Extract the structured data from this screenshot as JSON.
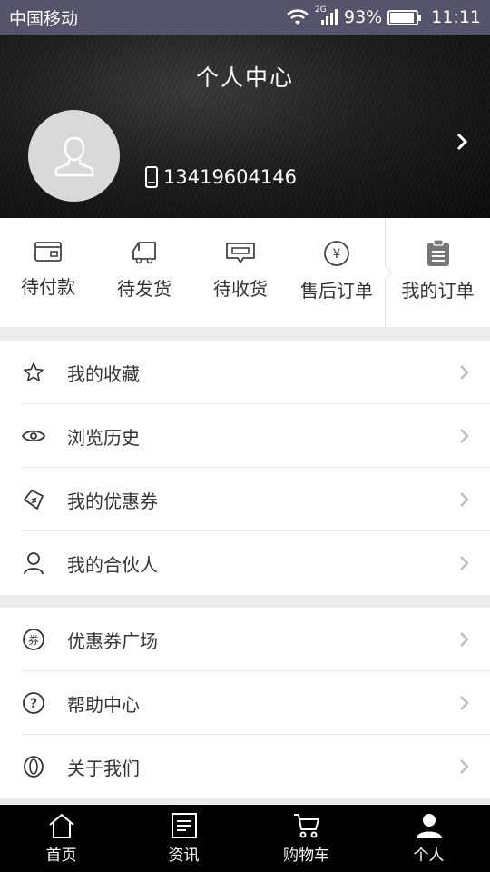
{
  "status_bar": {
    "carrier": "中国移动",
    "network": "2G",
    "battery": "93%",
    "battery_level": 0.93,
    "time": "11:11"
  },
  "header": {
    "title": "个人中心",
    "phone": "13419604146"
  },
  "orders": {
    "items": [
      {
        "label": "待付款",
        "icon": "wallet-icon"
      },
      {
        "label": "待发货",
        "icon": "truck-icon"
      },
      {
        "label": "待收货",
        "icon": "package-icon"
      },
      {
        "label": "售后订单",
        "icon": "yen-icon"
      }
    ],
    "all_label": "我的订单"
  },
  "menu_group_1": [
    {
      "label": "我的收藏",
      "icon": "star-icon"
    },
    {
      "label": "浏览历史",
      "icon": "eye-icon"
    },
    {
      "label": "我的优惠券",
      "icon": "tag-icon"
    },
    {
      "label": "我的合伙人",
      "icon": "person-icon"
    }
  ],
  "menu_group_2": [
    {
      "label": "优惠券广场",
      "icon": "coupon-icon"
    },
    {
      "label": "帮助中心",
      "icon": "help-icon"
    },
    {
      "label": "关于我们",
      "icon": "info-icon"
    }
  ],
  "tabbar": {
    "items": [
      {
        "label": "首页",
        "icon": "home-icon"
      },
      {
        "label": "资讯",
        "icon": "news-icon"
      },
      {
        "label": "购物车",
        "icon": "cart-icon"
      },
      {
        "label": "个人",
        "icon": "profile-icon"
      }
    ],
    "active": "个人"
  },
  "colors": {
    "status_bar": "#54546a",
    "tabbar": "#000000",
    "divider": "#ececec",
    "chevron": "#bdbdbd"
  }
}
